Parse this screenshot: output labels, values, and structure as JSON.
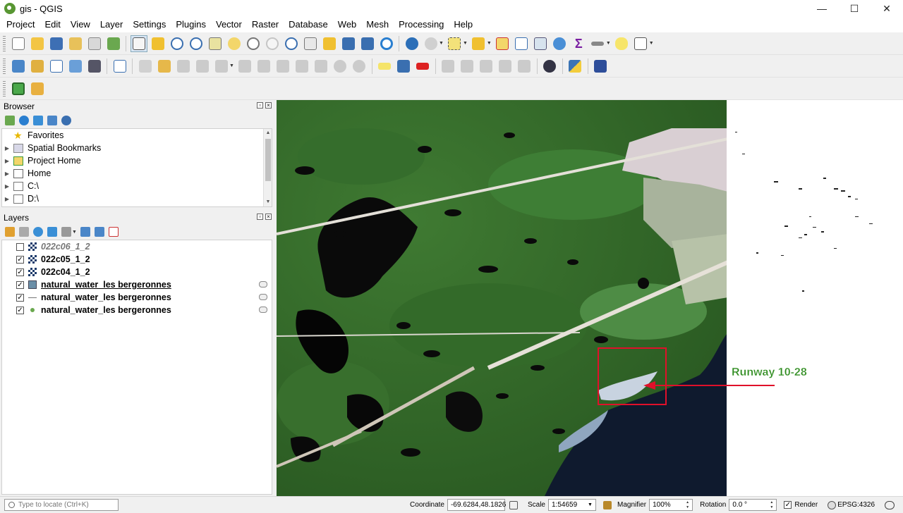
{
  "window": {
    "title": "gis - QGIS",
    "minimize": "—",
    "maximize": "☐",
    "close": "✕"
  },
  "menubar": [
    "Project",
    "Edit",
    "View",
    "Layer",
    "Settings",
    "Plugins",
    "Vector",
    "Raster",
    "Database",
    "Web",
    "Mesh",
    "Processing",
    "Help"
  ],
  "browser": {
    "title": "Browser",
    "items": [
      {
        "label": "Favorites",
        "icon": "star-icon"
      },
      {
        "label": "Spatial Bookmarks",
        "icon": "bookmark-icon"
      },
      {
        "label": "Project Home",
        "icon": "project-home-icon"
      },
      {
        "label": "Home",
        "icon": "home-icon"
      },
      {
        "label": "C:\\",
        "icon": "folder-icon"
      },
      {
        "label": "D:\\",
        "icon": "folder-icon"
      }
    ]
  },
  "layers": {
    "title": "Layers",
    "items": [
      {
        "name": "022c06_1_2",
        "checked": false,
        "type": "raster"
      },
      {
        "name": "022c05_1_2",
        "checked": true,
        "type": "raster"
      },
      {
        "name": "022c04_1_2",
        "checked": true,
        "type": "raster"
      },
      {
        "name": "natural_water_les bergeronnes",
        "checked": true,
        "type": "polygon"
      },
      {
        "name": "natural_water_les bergeronnes",
        "checked": true,
        "type": "line"
      },
      {
        "name": "natural_water_les bergeronnes",
        "checked": true,
        "type": "point"
      }
    ]
  },
  "map": {
    "annotation_label": "Runway 10-28",
    "annotation_color": "#e0102a",
    "label_color": "#2d8a1e"
  },
  "statusbar": {
    "locator_placeholder": "Type to locate (Ctrl+K)",
    "coordinate_label": "Coordinate",
    "coordinate_value": "-69.6284,48.1826",
    "scale_label": "Scale",
    "scale_value": "1:54659",
    "magnifier_label": "Magnifier",
    "magnifier_value": "100%",
    "rotation_label": "Rotation",
    "rotation_value": "0.0 °",
    "render_label": "Render",
    "crs_label": "EPSG:4326"
  }
}
